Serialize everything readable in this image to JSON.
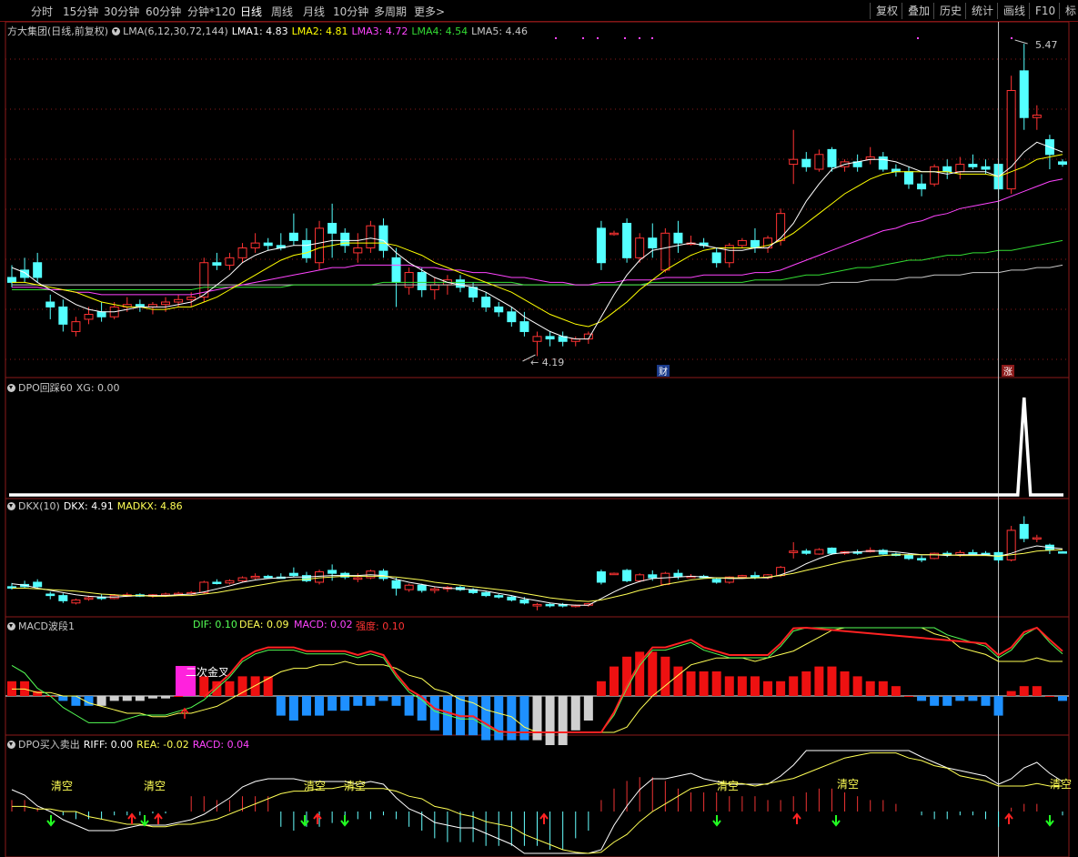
{
  "toolbar": {
    "periods": [
      "分时",
      "15分钟",
      "30分钟",
      "60分钟",
      "分钟*120",
      "日线",
      "周线",
      "月线",
      "10分钟",
      "多周期",
      "更多>"
    ],
    "active_period": "日线",
    "right_buttons": [
      "复权",
      "叠加",
      "历史",
      "统计",
      "画线",
      "F10",
      "标"
    ]
  },
  "main": {
    "stock_name": "方大集团(日线,前复权)",
    "indicator": "LMA(6,12,30,72,144)",
    "lines": [
      {
        "label": "LMA1: 4.83",
        "color": "#ffffff"
      },
      {
        "label": "LMA2: 4.81",
        "color": "#ffff00"
      },
      {
        "label": "LMA3: 4.72",
        "color": "#ff44ff"
      },
      {
        "label": "LMA4: 4.54",
        "color": "#33dd33"
      },
      {
        "label": "LMA5: 4.46",
        "color": "#c8c8c8"
      }
    ],
    "high_label": "5.47",
    "low_label": "4.19",
    "badge_cai": "财",
    "badge_zhang": "涨"
  },
  "dpo": {
    "title": "DPO回踩60",
    "xg": "XG: 0.00"
  },
  "dkx": {
    "title": "DKX(10)",
    "dkx": "DKX: 4.91",
    "madkx": "MADKX: 4.86"
  },
  "macd": {
    "title": "MACD波段1",
    "dif": "DIF: 0.10",
    "dea": "DEA: 0.09",
    "macd": "MACD: 0.02",
    "strength": "强度: 0.10",
    "cross_label": "二次金叉"
  },
  "dpo2": {
    "title": "DPO买入卖出",
    "riff": "RIFF: 0.00",
    "rea": "REA: -0.02",
    "racd": "RACD: 0.04",
    "clear_label": "清空"
  },
  "colors": {
    "up": "#ff3333",
    "down": "#54ffff",
    "border": "#8b1a1a"
  },
  "candles": [
    [
      4.52,
      4.57,
      4.48,
      4.5
    ],
    [
      4.55,
      4.6,
      4.5,
      4.52
    ],
    [
      4.58,
      4.62,
      4.5,
      4.52
    ],
    [
      4.42,
      4.45,
      4.35,
      4.4
    ],
    [
      4.4,
      4.43,
      4.3,
      4.33
    ],
    [
      4.3,
      4.36,
      4.28,
      4.34
    ],
    [
      4.35,
      4.4,
      4.33,
      4.37
    ],
    [
      4.38,
      4.42,
      4.34,
      4.36
    ],
    [
      4.36,
      4.42,
      4.35,
      4.4
    ],
    [
      4.4,
      4.44,
      4.38,
      4.41
    ],
    [
      4.41,
      4.43,
      4.38,
      4.4
    ],
    [
      4.4,
      4.42,
      4.37,
      4.41
    ],
    [
      4.41,
      4.44,
      4.38,
      4.42
    ],
    [
      4.42,
      4.45,
      4.4,
      4.43
    ],
    [
      4.43,
      4.46,
      4.4,
      4.44
    ],
    [
      4.44,
      4.6,
      4.42,
      4.58
    ],
    [
      4.58,
      4.62,
      4.55,
      4.57
    ],
    [
      4.57,
      4.62,
      4.55,
      4.6
    ],
    [
      4.6,
      4.66,
      4.58,
      4.64
    ],
    [
      4.64,
      4.7,
      4.62,
      4.66
    ],
    [
      4.66,
      4.68,
      4.63,
      4.65
    ],
    [
      4.65,
      4.7,
      4.63,
      4.64
    ],
    [
      4.7,
      4.78,
      4.65,
      4.67
    ],
    [
      4.67,
      4.72,
      4.58,
      4.6
    ],
    [
      4.58,
      4.75,
      4.55,
      4.72
    ],
    [
      4.74,
      4.82,
      4.6,
      4.7
    ],
    [
      4.7,
      4.72,
      4.62,
      4.65
    ],
    [
      4.62,
      4.7,
      4.58,
      4.64
    ],
    [
      4.64,
      4.75,
      4.62,
      4.73
    ],
    [
      4.73,
      4.76,
      4.6,
      4.63
    ],
    [
      4.6,
      4.64,
      4.4,
      4.5
    ],
    [
      4.48,
      4.56,
      4.45,
      4.54
    ],
    [
      4.54,
      4.56,
      4.44,
      4.47
    ],
    [
      4.47,
      4.52,
      4.43,
      4.49
    ],
    [
      4.49,
      4.53,
      4.45,
      4.51
    ],
    [
      4.51,
      4.53,
      4.46,
      4.48
    ],
    [
      4.48,
      4.5,
      4.42,
      4.44
    ],
    [
      4.44,
      4.46,
      4.38,
      4.4
    ],
    [
      4.4,
      4.42,
      4.36,
      4.38
    ],
    [
      4.38,
      4.4,
      4.32,
      4.34
    ],
    [
      4.34,
      4.38,
      4.28,
      4.3
    ],
    [
      4.26,
      4.3,
      4.2,
      4.28
    ],
    [
      4.28,
      4.3,
      4.24,
      4.27
    ],
    [
      4.28,
      4.3,
      4.24,
      4.26
    ],
    [
      4.26,
      4.28,
      4.24,
      4.27
    ],
    [
      4.27,
      4.3,
      4.25,
      4.29
    ],
    [
      4.72,
      4.75,
      4.55,
      4.58
    ],
    [
      4.7,
      4.71,
      4.69,
      4.7
    ],
    [
      4.74,
      4.76,
      4.58,
      4.6
    ],
    [
      4.6,
      4.7,
      4.58,
      4.68
    ],
    [
      4.68,
      4.74,
      4.6,
      4.64
    ],
    [
      4.55,
      4.72,
      4.54,
      4.7
    ],
    [
      4.7,
      4.75,
      4.62,
      4.66
    ],
    [
      4.66,
      4.69,
      4.65,
      4.66
    ],
    [
      4.66,
      4.68,
      4.64,
      4.65
    ],
    [
      4.62,
      4.64,
      4.56,
      4.58
    ],
    [
      4.58,
      4.66,
      4.56,
      4.65
    ],
    [
      4.65,
      4.68,
      4.64,
      4.67
    ],
    [
      4.67,
      4.72,
      4.62,
      4.64
    ],
    [
      4.64,
      4.69,
      4.62,
      4.68
    ],
    [
      4.67,
      4.8,
      4.65,
      4.78
    ],
    [
      4.98,
      5.12,
      4.9,
      5.0
    ],
    [
      5.0,
      5.03,
      4.95,
      4.97
    ],
    [
      4.96,
      5.04,
      4.95,
      5.02
    ],
    [
      5.04,
      5.05,
      4.95,
      4.97
    ],
    [
      4.97,
      5.0,
      4.95,
      4.99
    ],
    [
      4.99,
      5.02,
      4.95,
      4.97
    ],
    [
      5.0,
      5.05,
      4.98,
      5.01
    ],
    [
      5.01,
      5.03,
      4.95,
      4.96
    ],
    [
      4.96,
      4.98,
      4.93,
      4.95
    ],
    [
      4.95,
      4.97,
      4.88,
      4.9
    ],
    [
      4.9,
      4.94,
      4.85,
      4.88
    ],
    [
      4.9,
      4.98,
      4.89,
      4.97
    ],
    [
      4.97,
      5.0,
      4.92,
      4.95
    ],
    [
      4.95,
      5.01,
      4.92,
      4.98
    ],
    [
      4.98,
      5.02,
      4.96,
      4.97
    ],
    [
      4.97,
      5.0,
      4.94,
      4.96
    ],
    [
      4.98,
      5.0,
      4.84,
      4.88
    ],
    [
      4.88,
      5.34,
      4.86,
      5.28
    ],
    [
      5.36,
      5.47,
      5.12,
      5.17
    ],
    [
      5.17,
      5.22,
      5.12,
      5.18
    ],
    [
      5.08,
      5.1,
      4.96,
      5.02
    ],
    [
      4.99,
      5.0,
      4.97,
      4.98
    ]
  ],
  "lma": {
    "l1": [
      4.56,
      4.54,
      4.5,
      4.47,
      4.44,
      4.41,
      4.39,
      4.38,
      4.38,
      4.39,
      4.4,
      4.4,
      4.4,
      4.41,
      4.42,
      4.45,
      4.49,
      4.53,
      4.58,
      4.61,
      4.63,
      4.64,
      4.65,
      4.65,
      4.66,
      4.67,
      4.67,
      4.67,
      4.68,
      4.67,
      4.62,
      4.58,
      4.55,
      4.52,
      4.5,
      4.49,
      4.48,
      4.46,
      4.43,
      4.4,
      4.36,
      4.33,
      4.3,
      4.28,
      4.27,
      4.27,
      4.36,
      4.45,
      4.53,
      4.59,
      4.63,
      4.64,
      4.65,
      4.66,
      4.65,
      4.64,
      4.63,
      4.63,
      4.64,
      4.64,
      4.68,
      4.74,
      4.83,
      4.9,
      4.96,
      4.98,
      4.99,
      5.0,
      5.0,
      4.99,
      4.97,
      4.95,
      4.95,
      4.94,
      4.95,
      4.95,
      4.95,
      4.93,
      4.97,
      5.03,
      5.07,
      5.05,
      5.03
    ],
    "l2": [
      4.5,
      4.5,
      4.49,
      4.48,
      4.47,
      4.46,
      4.44,
      4.42,
      4.41,
      4.4,
      4.4,
      4.39,
      4.39,
      4.4,
      4.4,
      4.42,
      4.44,
      4.47,
      4.5,
      4.53,
      4.56,
      4.59,
      4.61,
      4.62,
      4.64,
      4.65,
      4.66,
      4.66,
      4.66,
      4.66,
      4.65,
      4.63,
      4.61,
      4.58,
      4.56,
      4.54,
      4.52,
      4.5,
      4.48,
      4.46,
      4.43,
      4.4,
      4.37,
      4.35,
      4.33,
      4.32,
      4.34,
      4.38,
      4.42,
      4.47,
      4.51,
      4.55,
      4.58,
      4.61,
      4.63,
      4.64,
      4.64,
      4.64,
      4.64,
      4.65,
      4.67,
      4.7,
      4.74,
      4.78,
      4.82,
      4.86,
      4.89,
      4.92,
      4.94,
      4.95,
      4.95,
      4.95,
      4.95,
      4.95,
      4.94,
      4.94,
      4.94,
      4.93,
      4.95,
      4.97,
      5.0,
      5.01,
      5.02
    ],
    "l3": [
      4.48,
      4.48,
      4.48,
      4.47,
      4.47,
      4.46,
      4.46,
      4.45,
      4.45,
      4.45,
      4.45,
      4.45,
      4.45,
      4.45,
      4.45,
      4.46,
      4.47,
      4.48,
      4.49,
      4.5,
      4.51,
      4.52,
      4.53,
      4.54,
      4.55,
      4.56,
      4.56,
      4.57,
      4.57,
      4.57,
      4.57,
      4.57,
      4.56,
      4.56,
      4.55,
      4.55,
      4.54,
      4.54,
      4.53,
      4.52,
      4.52,
      4.51,
      4.5,
      4.5,
      4.49,
      4.49,
      4.5,
      4.5,
      4.51,
      4.51,
      4.51,
      4.52,
      4.52,
      4.52,
      4.53,
      4.53,
      4.53,
      4.53,
      4.54,
      4.54,
      4.55,
      4.57,
      4.59,
      4.61,
      4.63,
      4.65,
      4.67,
      4.69,
      4.71,
      4.72,
      4.74,
      4.75,
      4.77,
      4.78,
      4.8,
      4.81,
      4.82,
      4.83,
      4.85,
      4.87,
      4.89,
      4.91,
      4.92
    ],
    "l4": [
      4.47,
      4.47,
      4.47,
      4.47,
      4.47,
      4.47,
      4.47,
      4.47,
      4.47,
      4.47,
      4.47,
      4.47,
      4.47,
      4.47,
      4.47,
      4.48,
      4.48,
      4.48,
      4.48,
      4.48,
      4.48,
      4.48,
      4.49,
      4.49,
      4.49,
      4.49,
      4.49,
      4.49,
      4.49,
      4.5,
      4.5,
      4.5,
      4.5,
      4.5,
      4.5,
      4.5,
      4.5,
      4.5,
      4.5,
      4.5,
      4.49,
      4.49,
      4.49,
      4.49,
      4.49,
      4.49,
      4.49,
      4.49,
      4.49,
      4.49,
      4.5,
      4.5,
      4.5,
      4.5,
      4.5,
      4.5,
      4.5,
      4.5,
      4.51,
      4.51,
      4.51,
      4.52,
      4.53,
      4.53,
      4.54,
      4.55,
      4.56,
      4.56,
      4.57,
      4.58,
      4.59,
      4.59,
      4.6,
      4.61,
      4.61,
      4.62,
      4.62,
      4.63,
      4.63,
      4.64,
      4.65,
      4.66,
      4.67
    ],
    "l5": [
      4.49,
      4.49,
      4.49,
      4.49,
      4.49,
      4.49,
      4.49,
      4.49,
      4.49,
      4.49,
      4.49,
      4.49,
      4.49,
      4.49,
      4.49,
      4.49,
      4.49,
      4.49,
      4.49,
      4.49,
      4.49,
      4.49,
      4.49,
      4.49,
      4.49,
      4.49,
      4.49,
      4.49,
      4.49,
      4.49,
      4.49,
      4.49,
      4.49,
      4.49,
      4.49,
      4.49,
      4.49,
      4.49,
      4.49,
      4.49,
      4.49,
      4.49,
      4.49,
      4.49,
      4.49,
      4.49,
      4.49,
      4.49,
      4.49,
      4.49,
      4.49,
      4.49,
      4.49,
      4.49,
      4.49,
      4.49,
      4.49,
      4.49,
      4.49,
      4.49,
      4.49,
      4.49,
      4.49,
      4.49,
      4.5,
      4.5,
      4.5,
      4.51,
      4.51,
      4.51,
      4.52,
      4.52,
      4.53,
      4.53,
      4.53,
      4.54,
      4.54,
      4.54,
      4.55,
      4.55,
      4.56,
      4.56,
      4.57
    ]
  },
  "macd_bars": [
    0.03,
    0.03,
    0.01,
    0.0,
    -0.01,
    -0.02,
    -0.02,
    -0.02,
    -0.01,
    -0.01,
    -0.01,
    -0.005,
    -0.005,
    0.0,
    0.04,
    0.04,
    0.03,
    0.03,
    0.04,
    0.04,
    0.04,
    -0.04,
    -0.05,
    -0.04,
    -0.04,
    -0.03,
    -0.03,
    -0.02,
    -0.02,
    -0.01,
    -0.02,
    -0.04,
    -0.05,
    -0.07,
    -0.08,
    -0.08,
    -0.08,
    -0.09,
    -0.09,
    -0.09,
    -0.09,
    -0.09,
    -0.1,
    -0.1,
    -0.07,
    -0.05,
    0.03,
    0.06,
    0.08,
    0.09,
    0.09,
    0.08,
    0.06,
    0.05,
    0.05,
    0.05,
    0.04,
    0.04,
    0.04,
    0.03,
    0.03,
    0.04,
    0.05,
    0.06,
    0.06,
    0.05,
    0.04,
    0.03,
    0.03,
    0.02,
    0.0,
    -0.01,
    -0.02,
    -0.02,
    -0.01,
    -0.01,
    -0.02,
    -0.04,
    0.01,
    0.02,
    0.02,
    0.0,
    -0.01
  ],
  "dpo_spike_index": 79
}
